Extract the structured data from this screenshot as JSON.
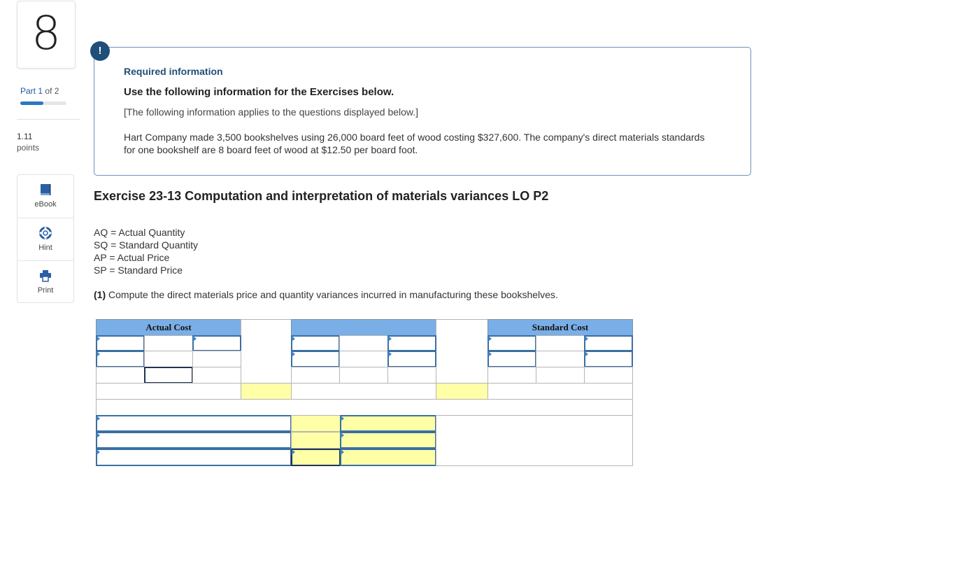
{
  "question": {
    "number": "8"
  },
  "part": {
    "prefix": "Part",
    "current": "1",
    "of_label": "of 2",
    "progress_fraction": 0.5
  },
  "points": {
    "value": "1.11",
    "label": "points"
  },
  "tools": [
    {
      "label": "eBook",
      "icon": "book-icon"
    },
    {
      "label": "Hint",
      "icon": "lifebuoy-icon"
    },
    {
      "label": "Print",
      "icon": "printer-icon"
    }
  ],
  "info": {
    "badge": "!",
    "required_title": "Required information",
    "use_title": "Use the following information for the Exercises below.",
    "applies": "[The following information applies to the questions displayed below.]",
    "scenario": "Hart Company made 3,500 bookshelves using 26,000 board feet of wood costing $327,600. The company's direct materials standards for one bookshelf are 8 board feet of wood at $12.50 per board foot."
  },
  "exercise": {
    "title": "Exercise 23-13 Computation and interpretation of materials variances LO P2",
    "definitions": [
      "AQ = Actual Quantity",
      "SQ = Standard Quantity",
      "AP = Actual Price",
      "SP = Standard Price"
    ],
    "question_number": "(1)",
    "question_text": " Compute the direct materials price and quantity variances incurred in manufacturing these bookshelves."
  },
  "worksheet": {
    "actual_cost_header": "Actual Cost",
    "middle_header": "",
    "standard_cost_header": "Standard Cost"
  },
  "colors": {
    "header_blue": "#7aaee6",
    "answer_yellow": "#ffffa8",
    "badge_navy": "#1f4e79"
  }
}
